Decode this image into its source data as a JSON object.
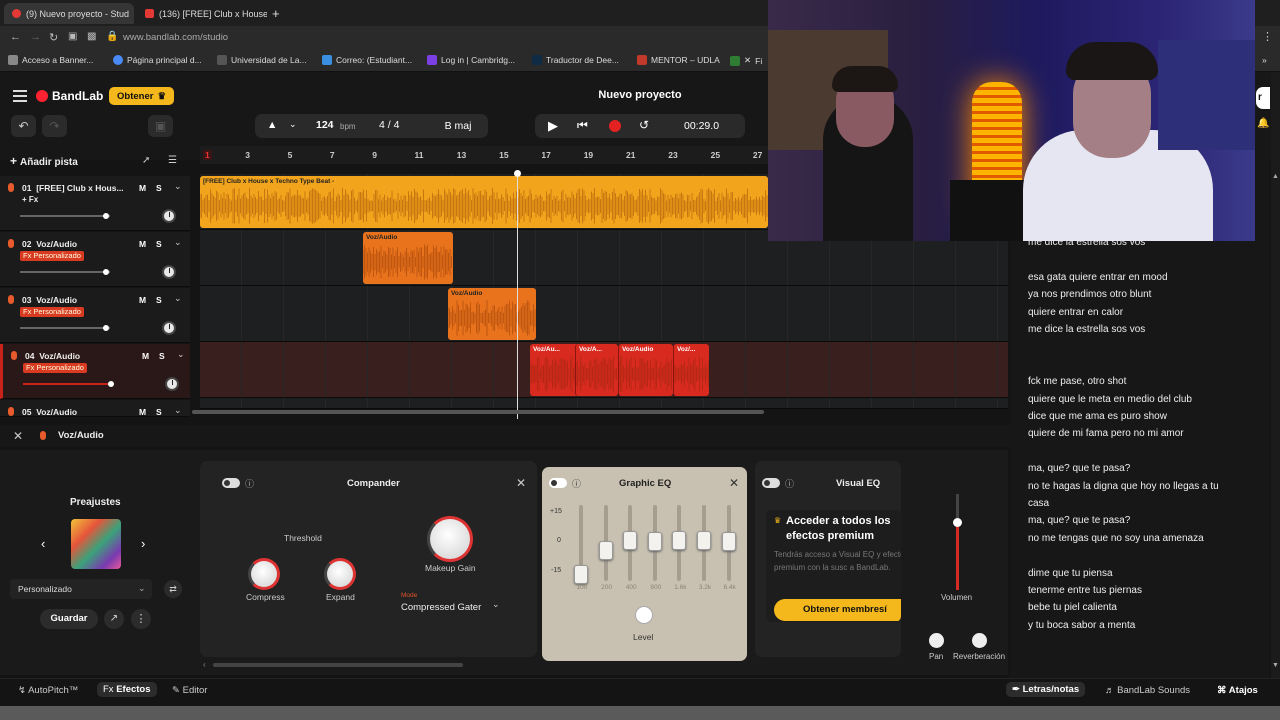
{
  "browser": {
    "tabs": [
      {
        "label": "(9) Nuevo proyecto - Stud",
        "active": true
      },
      {
        "label": "(136) [FREE] Club x House",
        "active": false
      }
    ],
    "new_tab": "+",
    "url": "www.bandlab.com/studio",
    "bookmarks": [
      "Acceso a Banner...",
      "Página principal d...",
      "Universidad de La...",
      "Correo: (Estudiant...",
      "Log in | Cambridg...",
      "Traductor de Dee...",
      "MENTOR – UDLA",
      "Fi"
    ]
  },
  "app": {
    "brand": "BandLab",
    "get_button": "Obtener",
    "project_title": "Nuevo proyecto",
    "tempo": "124",
    "tempo_unit": "bpm",
    "time_sig": "4 / 4",
    "key": "B maj",
    "time": "00:29.0",
    "add_track": "Añadir pista"
  },
  "ruler": [
    "1",
    "3",
    "5",
    "7",
    "9",
    "11",
    "13",
    "15",
    "17",
    "19",
    "21",
    "23",
    "25",
    "27"
  ],
  "tracks": [
    {
      "num": "01",
      "name": "[FREE] Club x Hous...",
      "fx": "+ Fx",
      "fx_style": "plain",
      "slider": 0.97,
      "armed": false
    },
    {
      "num": "02",
      "name": "Voz/Audio",
      "fx": "Fx Personalizado",
      "fx_style": "badge",
      "slider": 0.97,
      "armed": false
    },
    {
      "num": "03",
      "name": "Voz/Audio",
      "fx": "Fx Personalizado",
      "fx_style": "badge",
      "slider": 0.97,
      "armed": false
    },
    {
      "num": "04",
      "name": "Voz/Audio",
      "fx": "Fx Personalizado",
      "fx_style": "badge",
      "slider": 0.99,
      "armed": true
    },
    {
      "num": "05",
      "name": "Voz/Audio",
      "fx": "",
      "fx_style": "badge",
      "slider": 0,
      "armed": false
    }
  ],
  "mute_label": "M",
  "solo_label": "S",
  "clips": {
    "beat": "[FREE] Club x House x Techno Type Beat -",
    "voz2": "Voz/Audio",
    "voz3": "Voz/Audio",
    "voz4": [
      "Voz/Au...",
      "Voz/A...",
      "Voz/Audio",
      "Voz/..."
    ]
  },
  "fx_panel": {
    "track": "Voz/Audio",
    "presets_title": "Preajustes",
    "preset_value": "Personalizado",
    "save": "Guardar",
    "compander": {
      "title": "Compander",
      "threshold": "Threshold",
      "compress": "Compress",
      "expand": "Expand",
      "makeup": "Makeup Gain",
      "mode_label": "Mode",
      "mode_value": "Compressed Gater"
    },
    "graphic_eq": {
      "title": "Graphic EQ",
      "db_labels": [
        "+15",
        "0",
        "-15"
      ],
      "bands": [
        "100",
        "200",
        "400",
        "800",
        "1.6k",
        "3.2k",
        "6.4k"
      ],
      "levels": [
        -0.75,
        -0.05,
        0.25,
        0.2,
        0.25,
        0.25,
        0.2
      ],
      "level": "Level"
    },
    "visual_eq": {
      "title": "Visual EQ",
      "premium_title": "Acceder a todos los efectos premium",
      "premium_text": "Tendrás acceso a Visual EQ y efectos premium con la susc a BandLab.",
      "premium_cta": "Obtener membresí"
    },
    "volume": "Volumen",
    "pan": "Pan",
    "reverb": "Reverberación"
  },
  "bottom": {
    "autopitch": "AutoPitch™",
    "efectos": "Efectos",
    "editor": "Editor",
    "lyrics": "Letras/notas",
    "sounds": "BandLab Sounds",
    "shortcuts": "Atajos"
  },
  "lyrics": [
    "me dice la estrella sos vos",
    "",
    "esa gata quiere entrar en mood",
    "ya nos prendimos otro blunt",
    "quiere entrar en calor",
    "me dice la estrella sos vos",
    "",
    "",
    "fck me pase, otro shot",
    "quiere que le meta en medio del club",
    "dice que me ama es puro show",
    "quiere de mi fama pero no mi amor",
    "",
    "ma, que? que te pasa?",
    "no te hagas la digna que hoy no llegas a tu",
    "casa",
    "ma, que? que te pasa?",
    "no me tengas que no soy una amenaza",
    "",
    "dime que tu piensa",
    "tenerme entre tus piernas",
    "bebe tu piel calienta",
    "y tu boca sabor a menta"
  ],
  "colors": {
    "accent": "#f5a623",
    "record": "#e52222",
    "armed": "#c8231b"
  }
}
